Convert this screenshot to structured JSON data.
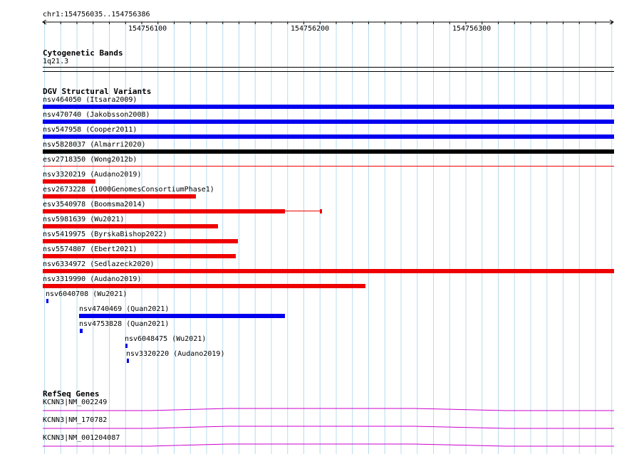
{
  "ruler": {
    "range_label": "chr1:154756035..154756386",
    "ticks": [
      "154756100",
      "154756200",
      "154756300"
    ]
  },
  "cytoband": {
    "title": "Cytogenetic Bands",
    "band": "1q21.3"
  },
  "dgv": {
    "title": "DGV Structural Variants",
    "variants": [
      {
        "label": "nsv464050 (Itsara2009)",
        "color": "#0000ee"
      },
      {
        "label": "nsv470740 (Jakobsson2008)",
        "color": "#0000ee"
      },
      {
        "label": "nsv547958 (Cooper2011)",
        "color": "#0000ee"
      },
      {
        "label": "nsv5828037 (Almarri2020)",
        "color": "#000000"
      },
      {
        "label": "esv2718350 (Wong2012b)",
        "color": "#ee0000"
      },
      {
        "label": "nsv3320219 (Audano2019)",
        "color": "#ee0000"
      },
      {
        "label": "esv2673228 (1000GenomesConsortiumPhase1)",
        "color": "#ee0000"
      },
      {
        "label": "esv3540978 (Boomsma2014)",
        "color": "#ee0000"
      },
      {
        "label": "nsv5981639 (Wu2021)",
        "color": "#ee0000"
      },
      {
        "label": "nsv5419975 (ByrskaBishop2022)",
        "color": "#ee0000"
      },
      {
        "label": "nsv5574807 (Ebert2021)",
        "color": "#ee0000"
      },
      {
        "label": "nsv6334972 (Sedlazeck2020)",
        "color": "#ee0000"
      },
      {
        "label": "nsv3319990 (Audano2019)",
        "color": "#ee0000"
      },
      {
        "label": "nsv6040708 (Wu2021)",
        "color": "#0000ee"
      },
      {
        "label": "nsv4740469 (Quan2021)",
        "color": "#0000ee"
      },
      {
        "label": "nsv4753828 (Quan2021)",
        "color": "#0000ee"
      },
      {
        "label": "nsv6048475 (Wu2021)",
        "color": "#0000ee"
      },
      {
        "label": "nsv3320220 (Audano2019)",
        "color": "#0000ee"
      }
    ]
  },
  "refseq": {
    "title": "RefSeq Genes",
    "genes": [
      {
        "label": "KCNN3|NM_002249",
        "color": "#cc00cc"
      },
      {
        "label": "KCNN3|NM_170782",
        "color": "#cc00cc"
      },
      {
        "label": "KCNN3|NM_001204087",
        "color": "#cc00cc"
      }
    ]
  }
}
